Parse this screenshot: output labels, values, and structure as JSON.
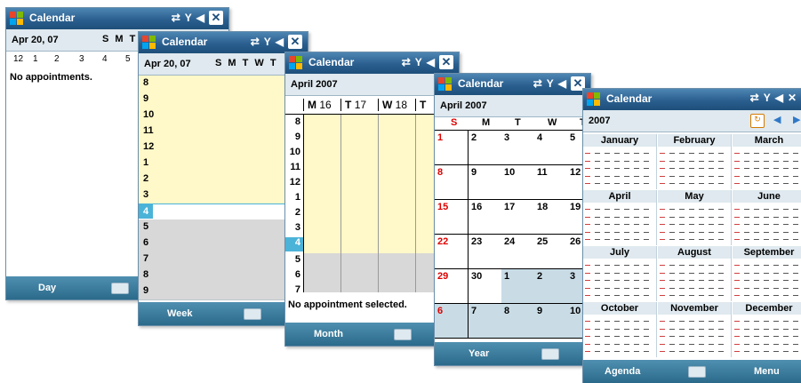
{
  "title": "Calendar",
  "day": {
    "date": "Apr 20, 07",
    "dow": "S M T W T",
    "dates": [
      "12",
      "1",
      "2",
      "3",
      "4",
      "5"
    ],
    "message": "No appointments.",
    "softkey": "Day"
  },
  "week": {
    "date": "Apr 20, 07",
    "dow": "S M T W T",
    "hours": [
      "8",
      "9",
      "10",
      "11",
      "12",
      "1",
      "2",
      "3",
      "4",
      "5",
      "6",
      "7",
      "8",
      "9"
    ],
    "softkey": "Week"
  },
  "weekgrid": {
    "title": "April 2007",
    "cols": [
      {
        "d": "M",
        "n": "16"
      },
      {
        "d": "T",
        "n": "17"
      },
      {
        "d": "W",
        "n": "18"
      },
      {
        "d": "T",
        "n": ""
      }
    ],
    "hours": [
      "8",
      "9",
      "10",
      "11",
      "12",
      "1",
      "2",
      "3",
      "4",
      "5",
      "6",
      "7"
    ],
    "message": "No appointment selected.",
    "softkey": "Month"
  },
  "month": {
    "title": "April 2007",
    "dow": [
      "S",
      "M",
      "T",
      "W",
      "T"
    ],
    "weeks": [
      [
        "1",
        "2",
        "3",
        "4",
        "5"
      ],
      [
        "8",
        "9",
        "10",
        "11",
        "12"
      ],
      [
        "15",
        "16",
        "17",
        "18",
        "19"
      ],
      [
        "22",
        "23",
        "24",
        "25",
        "26"
      ],
      [
        "29",
        "30",
        "1",
        "2",
        "3"
      ],
      [
        "6",
        "7",
        "8",
        "9",
        "10"
      ]
    ],
    "softkey": "Year"
  },
  "year": {
    "title": "2007",
    "months": [
      "January",
      "February",
      "March",
      "April",
      "May",
      "June",
      "July",
      "August",
      "September",
      "October",
      "November",
      "December"
    ],
    "left_softkey": "Agenda",
    "right_softkey": "Menu"
  },
  "colors": {
    "accent": "#2a5f8f",
    "highlight": "#4bb3d8",
    "today": "#fff8c8",
    "sunday": "#dd0000"
  }
}
